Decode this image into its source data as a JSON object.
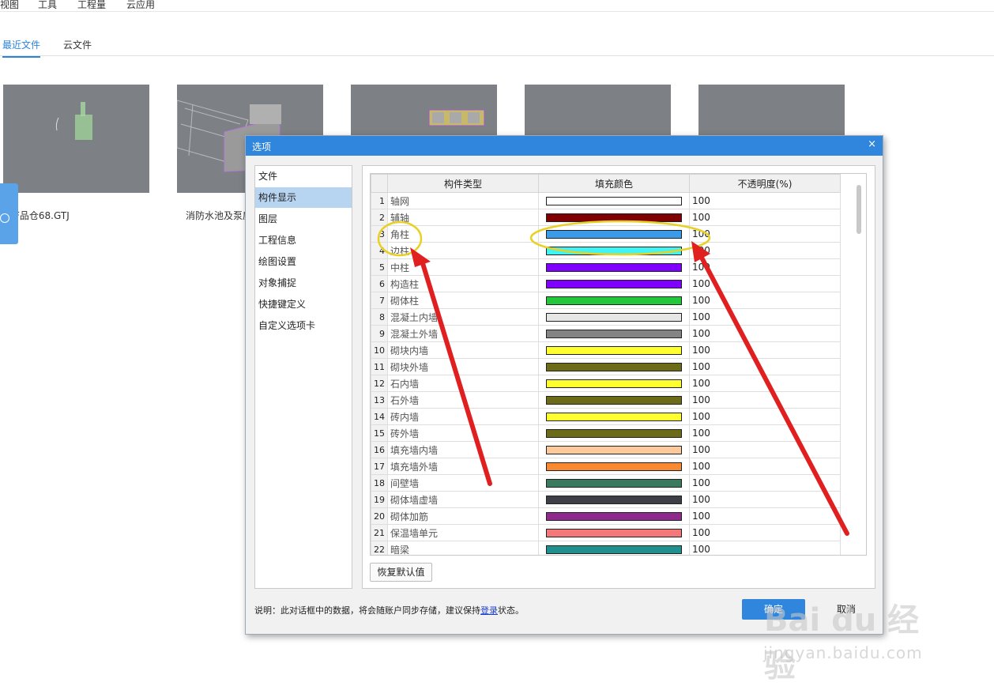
{
  "menu": [
    "视图",
    "工具",
    "工程量",
    "云应用"
  ],
  "tabs": [
    {
      "label": "最近文件",
      "active": true
    },
    {
      "label": "云文件",
      "active": false
    }
  ],
  "recent_files": [
    {
      "name": "F品仓68.GTJ"
    },
    {
      "name": "消防水池及泵房"
    },
    {
      "name": ""
    },
    {
      "name": ""
    },
    {
      "name": ""
    }
  ],
  "dialog": {
    "title": "选项",
    "close_glyph": "×",
    "nav": [
      "文件",
      "构件显示",
      "图层",
      "工程信息",
      "绘图设置",
      "对象捕捉",
      "快捷键定义",
      "自定义选项卡"
    ],
    "nav_selected_index": 1,
    "table": {
      "headers": [
        "构件类型",
        "填充颜色",
        "不透明度(%)"
      ],
      "rows": [
        {
          "n": "1",
          "type": "轴网",
          "color": "#ffffff",
          "opacity": "100"
        },
        {
          "n": "2",
          "type": "辅轴",
          "color": "#7f0000",
          "opacity": "100"
        },
        {
          "n": "3",
          "type": "角柱",
          "color": "#3c9be8",
          "opacity": "100"
        },
        {
          "n": "4",
          "type": "边柱",
          "color": "#40f4f4",
          "opacity": "100"
        },
        {
          "n": "5",
          "type": "中柱",
          "color": "#8000ff",
          "opacity": "100"
        },
        {
          "n": "6",
          "type": "构造柱",
          "color": "#8000ff",
          "opacity": "100"
        },
        {
          "n": "7",
          "type": "砌体柱",
          "color": "#22c83a",
          "opacity": "100"
        },
        {
          "n": "8",
          "type": "混凝土内墙",
          "color": "#e6e6e6",
          "opacity": "100"
        },
        {
          "n": "9",
          "type": "混凝土外墙",
          "color": "#848484",
          "opacity": "100"
        },
        {
          "n": "10",
          "type": "砌块内墙",
          "color": "#ffff30",
          "opacity": "100"
        },
        {
          "n": "11",
          "type": "砌块外墙",
          "color": "#6b6b18",
          "opacity": "100"
        },
        {
          "n": "12",
          "type": "石内墙",
          "color": "#ffff30",
          "opacity": "100"
        },
        {
          "n": "13",
          "type": "石外墙",
          "color": "#6b6b18",
          "opacity": "100"
        },
        {
          "n": "14",
          "type": "砖内墙",
          "color": "#ffff30",
          "opacity": "100"
        },
        {
          "n": "15",
          "type": "砖外墙",
          "color": "#6b6b18",
          "opacity": "100"
        },
        {
          "n": "16",
          "type": "填充墙内墙",
          "color": "#fcc99c",
          "opacity": "100"
        },
        {
          "n": "17",
          "type": "填充墙外墙",
          "color": "#f98a32",
          "opacity": "100"
        },
        {
          "n": "18",
          "type": "间壁墙",
          "color": "#3a7a5e",
          "opacity": "100"
        },
        {
          "n": "19",
          "type": "砌体墙虚墙",
          "color": "#3e3e46",
          "opacity": "100"
        },
        {
          "n": "20",
          "type": "砌体加筋",
          "color": "#8e2a8e",
          "opacity": "100"
        },
        {
          "n": "21",
          "type": "保温墙单元",
          "color": "#f4787a",
          "opacity": "100"
        },
        {
          "n": "22",
          "type": "暗梁",
          "color": "#20908e",
          "opacity": "100"
        }
      ]
    },
    "restore_label": "恢复默认值",
    "note_prefix": "说明：此对话框中的数据，将会随账户同步存储，建议保持",
    "note_link": "登录",
    "note_suffix": "状态。",
    "ok_label": "确定",
    "cancel_label": "取消"
  },
  "watermark": {
    "logo": "Bai du 经验",
    "url": "jingyan.baidu.com"
  },
  "colors": {
    "accent": "#2f86dc",
    "annotation_arrow": "#e02020",
    "annotation_circle": "#e8d024"
  }
}
